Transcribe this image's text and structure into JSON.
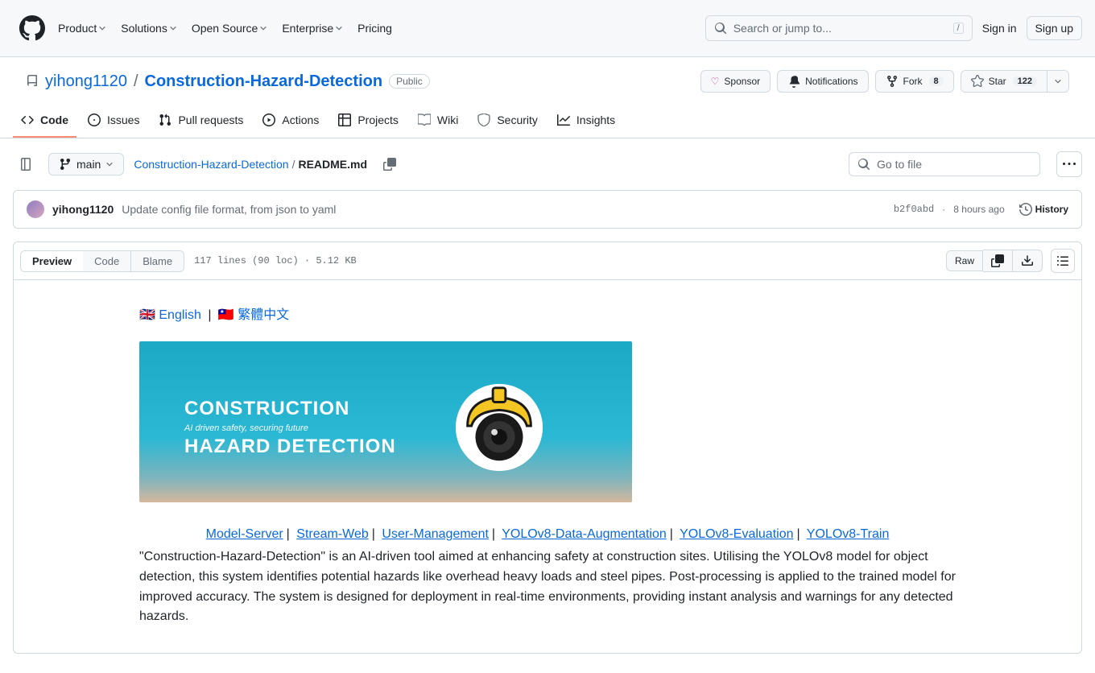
{
  "header": {
    "nav": [
      "Product",
      "Solutions",
      "Open Source",
      "Enterprise",
      "Pricing"
    ],
    "search_placeholder": "Search or jump to...",
    "search_key": "/",
    "sign_in": "Sign in",
    "sign_up": "Sign up"
  },
  "repo": {
    "owner": "yihong1120",
    "name": "Construction-Hazard-Detection",
    "visibility": "Public",
    "actions": {
      "sponsor": "Sponsor",
      "notifications": "Notifications",
      "fork": "Fork",
      "fork_count": "8",
      "star": "Star",
      "star_count": "122"
    },
    "tabs": [
      "Code",
      "Issues",
      "Pull requests",
      "Actions",
      "Projects",
      "Wiki",
      "Security",
      "Insights"
    ]
  },
  "file_nav": {
    "branch": "main",
    "path_repo": "Construction-Hazard-Detection",
    "path_file": "README.md",
    "goto_placeholder": "Go to file"
  },
  "commit": {
    "author": "yihong1120",
    "message": "Update config file format, from json to yaml",
    "sha": "b2f0abd",
    "rel_time": "8 hours ago",
    "history": "History"
  },
  "file_toolbar": {
    "tabs": [
      "Preview",
      "Code",
      "Blame"
    ],
    "info": "117 lines (90 loc) · 5.12 KB",
    "raw": "Raw"
  },
  "readme": {
    "lang1_flag": "🇬🇧",
    "lang1": "English",
    "lang2_flag": "🇹🇼",
    "lang2": "繁體中文",
    "banner_top": "Construction",
    "banner_sub": "AI driven safety, securing future",
    "banner_bottom": "Hazard Detection",
    "nav_links": [
      "Model-Server",
      "Stream-Web",
      "User-Management",
      "YOLOv8-Data-Augmentation",
      "YOLOv8-Evaluation",
      "YOLOv8-Train"
    ],
    "description": "\"Construction-Hazard-Detection\" is an AI-driven tool aimed at enhancing safety at construction sites. Utilising the YOLOv8 model for object detection, this system identifies potential hazards like overhead heavy loads and steel pipes. Post-processing is applied to the trained model for improved accuracy. The system is designed for deployment in real-time environments, providing instant analysis and warnings for any detected hazards."
  }
}
